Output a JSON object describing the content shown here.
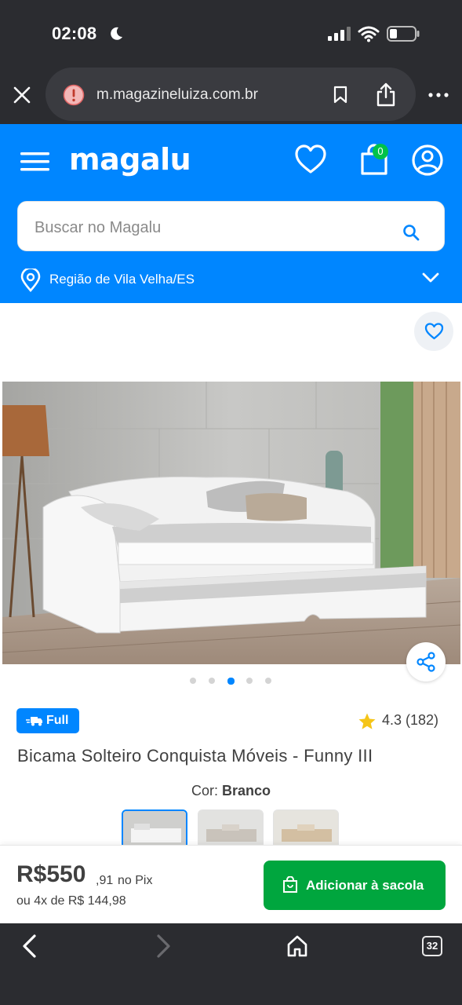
{
  "status_bar": {
    "time": "02:08"
  },
  "browser": {
    "url": "m.magazineluiza.com.br",
    "tab_count": "32"
  },
  "header": {
    "logo": "magalu",
    "cart_count": "0",
    "search": {
      "placeholder": "Buscar no Magalu"
    },
    "location": "Região de Vila Velha/ES"
  },
  "product": {
    "badge": "Full",
    "rating": "4.3 (182)",
    "title": "Bicama Solteiro Conquista Móveis - Funny III",
    "color_label": "Cor:",
    "color_value": "Branco",
    "carousel": {
      "count": 5,
      "active_index": 2
    }
  },
  "price": {
    "main": "R$550",
    "cents": ",91",
    "pix_label": "no Pix",
    "installments": "ou 4x de R$ 144,98"
  },
  "actions": {
    "add_to_bag": "Adicionar à sacola"
  },
  "colors": {
    "brand": "#0086ff",
    "cta": "#00a63e",
    "badge_green": "#00c24a",
    "star": "#f5c518"
  }
}
